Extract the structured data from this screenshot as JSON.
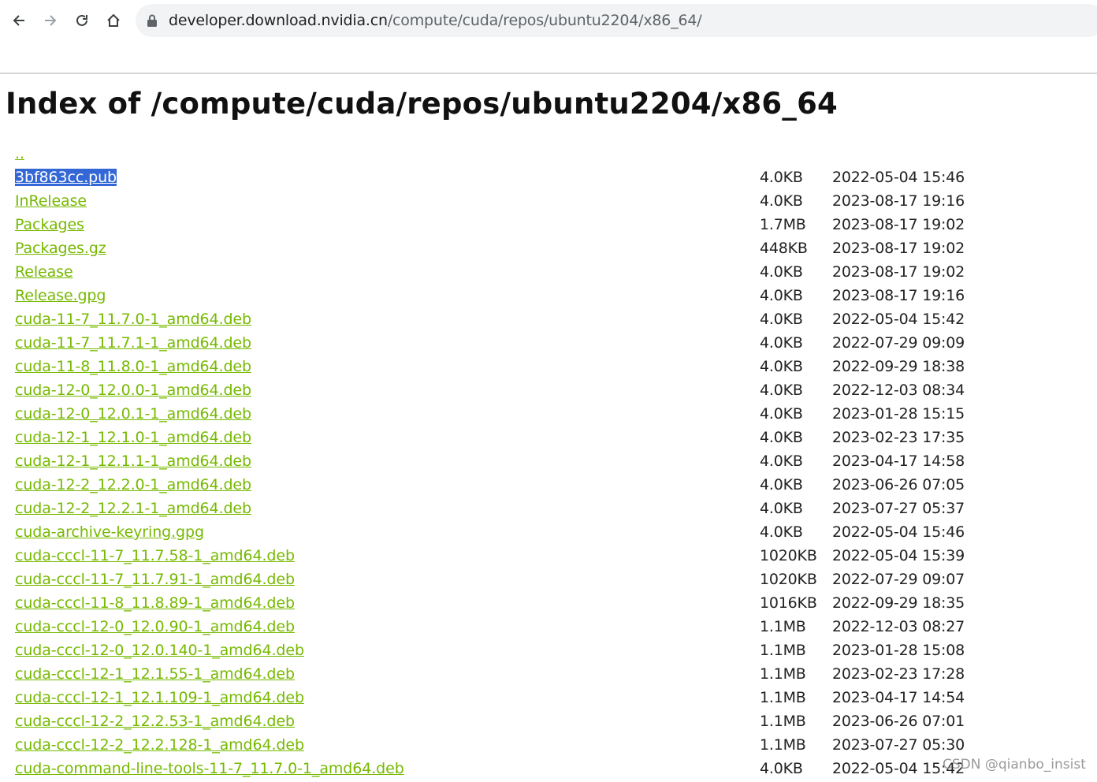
{
  "browser": {
    "url_host": "developer.download.nvidia.cn",
    "url_path": "/compute/cuda/repos/ubuntu2204/x86_64/"
  },
  "page": {
    "title": "Index of /compute/cuda/repos/ubuntu2204/x86_64"
  },
  "files": [
    {
      "name": "..",
      "size": "",
      "date": ""
    },
    {
      "name": "3bf863cc.pub",
      "size": "4.0KB",
      "date": "2022-05-04 15:46",
      "selected": true
    },
    {
      "name": "InRelease",
      "size": "4.0KB",
      "date": "2023-08-17 19:16"
    },
    {
      "name": "Packages",
      "size": "1.7MB",
      "date": "2023-08-17 19:02"
    },
    {
      "name": "Packages.gz",
      "size": "448KB",
      "date": "2023-08-17 19:02"
    },
    {
      "name": "Release",
      "size": "4.0KB",
      "date": "2023-08-17 19:02"
    },
    {
      "name": "Release.gpg",
      "size": "4.0KB",
      "date": "2023-08-17 19:16"
    },
    {
      "name": "cuda-11-7_11.7.0-1_amd64.deb",
      "size": "4.0KB",
      "date": "2022-05-04 15:42"
    },
    {
      "name": "cuda-11-7_11.7.1-1_amd64.deb",
      "size": "4.0KB",
      "date": "2022-07-29 09:09"
    },
    {
      "name": "cuda-11-8_11.8.0-1_amd64.deb",
      "size": "4.0KB",
      "date": "2022-09-29 18:38"
    },
    {
      "name": "cuda-12-0_12.0.0-1_amd64.deb",
      "size": "4.0KB",
      "date": "2022-12-03 08:34"
    },
    {
      "name": "cuda-12-0_12.0.1-1_amd64.deb",
      "size": "4.0KB",
      "date": "2023-01-28 15:15"
    },
    {
      "name": "cuda-12-1_12.1.0-1_amd64.deb",
      "size": "4.0KB",
      "date": "2023-02-23 17:35"
    },
    {
      "name": "cuda-12-1_12.1.1-1_amd64.deb",
      "size": "4.0KB",
      "date": "2023-04-17 14:58"
    },
    {
      "name": "cuda-12-2_12.2.0-1_amd64.deb",
      "size": "4.0KB",
      "date": "2023-06-26 07:05"
    },
    {
      "name": "cuda-12-2_12.2.1-1_amd64.deb",
      "size": "4.0KB",
      "date": "2023-07-27 05:37"
    },
    {
      "name": "cuda-archive-keyring.gpg",
      "size": "4.0KB",
      "date": "2022-05-04 15:46"
    },
    {
      "name": "cuda-cccl-11-7_11.7.58-1_amd64.deb",
      "size": "1020KB",
      "date": "2022-05-04 15:39"
    },
    {
      "name": "cuda-cccl-11-7_11.7.91-1_amd64.deb",
      "size": "1020KB",
      "date": "2022-07-29 09:07"
    },
    {
      "name": "cuda-cccl-11-8_11.8.89-1_amd64.deb",
      "size": "1016KB",
      "date": "2022-09-29 18:35"
    },
    {
      "name": "cuda-cccl-12-0_12.0.90-1_amd64.deb",
      "size": "1.1MB",
      "date": "2022-12-03 08:27"
    },
    {
      "name": "cuda-cccl-12-0_12.0.140-1_amd64.deb",
      "size": "1.1MB",
      "date": "2023-01-28 15:08"
    },
    {
      "name": "cuda-cccl-12-1_12.1.55-1_amd64.deb",
      "size": "1.1MB",
      "date": "2023-02-23 17:28"
    },
    {
      "name": "cuda-cccl-12-1_12.1.109-1_amd64.deb",
      "size": "1.1MB",
      "date": "2023-04-17 14:54"
    },
    {
      "name": "cuda-cccl-12-2_12.2.53-1_amd64.deb",
      "size": "1.1MB",
      "date": "2023-06-26 07:01"
    },
    {
      "name": "cuda-cccl-12-2_12.2.128-1_amd64.deb",
      "size": "1.1MB",
      "date": "2023-07-27 05:30"
    },
    {
      "name": "cuda-command-line-tools-11-7_11.7.0-1_amd64.deb",
      "size": "4.0KB",
      "date": "2022-05-04 15:42"
    }
  ],
  "watermark": "CSDN @qianbo_insist",
  "colors": {
    "link": "#76b900",
    "selection": "#3467d6"
  }
}
